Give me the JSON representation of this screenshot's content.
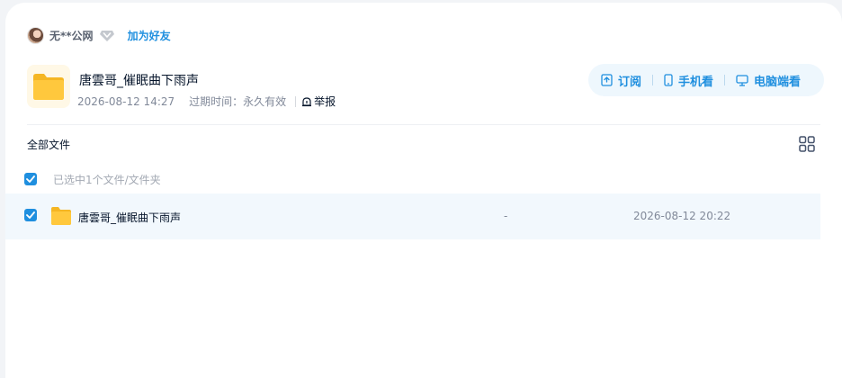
{
  "user": {
    "name": "无**公网",
    "add_friend_label": "加为好友"
  },
  "share": {
    "title": "唐雲哥_催眠曲下雨声",
    "created": "2026-08-12 14:27",
    "expiry_label": "过期时间：",
    "expiry_value": "永久有效",
    "report_label": "举报"
  },
  "actions": {
    "subscribe_label": "订阅",
    "mobile_label": "手机看",
    "desktop_label": "电脑端看"
  },
  "list": {
    "breadcrumb": "全部文件",
    "selected_text": "已选中1个文件/文件夹",
    "files": [
      {
        "name": "唐雲哥_催眠曲下雨声",
        "size": "-",
        "modified": "2026-08-12 20:22",
        "selected": true
      }
    ]
  },
  "colors": {
    "accent": "#1f8fdf",
    "row_highlight": "#f2f8fd",
    "folder": "#ffc83d"
  },
  "icons": [
    "vip-diamond-icon",
    "folder-icon",
    "report-icon",
    "subscribe-icon",
    "phone-icon",
    "monitor-icon",
    "grid-view-icon",
    "check-icon"
  ]
}
